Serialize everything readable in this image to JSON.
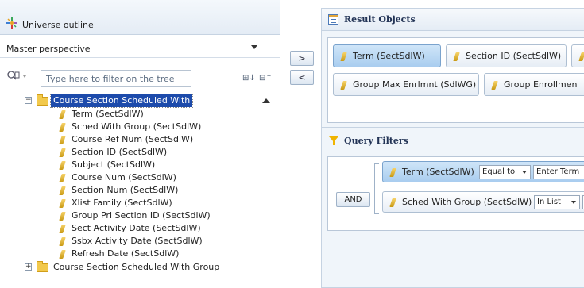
{
  "outline": {
    "title": "Universe outline",
    "perspective": "Master perspective",
    "filter_placeholder": "Type here to filter on the tree",
    "tree": {
      "root_label": "Course Section Scheduled With",
      "children": [
        "Term (SectSdlW)",
        "Sched With Group (SectSdlW)",
        "Course Ref Num (SectSdlW)",
        "Section ID (SectSdlW)",
        "Subject (SectSdlW)",
        "Course Num (SectSdlW)",
        "Section Num (SectSdlW)",
        "Xlist Family (SectSdlW)",
        "Group Pri Section ID (SectSdlW)",
        "Sect Activity Date (SectSdlW)",
        "Ssbx Activity Date (SectSdlW)",
        "Refresh Date (SectSdlW)"
      ],
      "next_folder": "Course Section Scheduled With Group"
    }
  },
  "transfer": {
    "add_label": ">",
    "remove_label": "<"
  },
  "result_objects": {
    "title": "Result Objects",
    "row1": [
      "Term (SectSdlW)",
      "Section ID (SectSdlW)"
    ],
    "row2": [
      "Group Max Enrlmnt (SdlWG)",
      "Group Enrollmen"
    ]
  },
  "query_filters": {
    "title": "Query Filters",
    "and_label": "AND",
    "filters": [
      {
        "object": "Term (SectSdlW)",
        "operator": "Equal to",
        "value": "Enter Term"
      },
      {
        "object": "Sched With Group (SectSdlW)",
        "operator": "In List",
        "value": ""
      }
    ]
  },
  "icons": {
    "outline": "universe-outline-icon",
    "result_objects": "result-objects-icon",
    "query_filters": "funnel-icon",
    "object": "dimension-object-icon",
    "folder": "folder-icon"
  }
}
